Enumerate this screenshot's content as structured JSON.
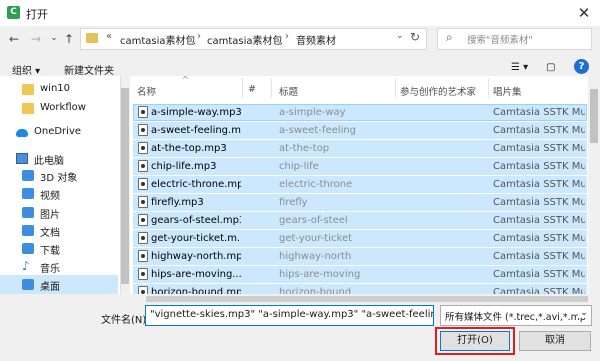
{
  "window": {
    "title": "打开",
    "app_icon_glyph": "C",
    "close_glyph": "✕"
  },
  "address_bar": {
    "back_glyph": "←",
    "forward_glyph": "→",
    "recent_glyph": "⌄",
    "up_glyph": "↑",
    "overflow": "«",
    "crumbs": [
      "camtasia素材包",
      "camtasia素材包",
      "音频素材"
    ],
    "separator": "›",
    "dropdown_glyph": "⌄",
    "refresh_glyph": "↻"
  },
  "search": {
    "placeholder": "搜索\"音频素材\"",
    "icon_glyph": "⌕"
  },
  "toolbar": {
    "organize": "组织 ▾",
    "new_folder": "新建文件夹",
    "view_glyph": "☰ ▾",
    "pane_glyph": "▢",
    "help_glyph": "?"
  },
  "nav": {
    "items": [
      {
        "label": "win10",
        "icon": "folder-icon",
        "selected": false
      },
      {
        "label": "Workflow",
        "icon": "folder-icon",
        "selected": false
      },
      {
        "label": "OneDrive",
        "icon": "cloud-icon",
        "selected": false
      },
      {
        "label": "此电脑",
        "icon": "computer-icon",
        "selected": false
      },
      {
        "label": "3D 对象",
        "icon": "3d-objects-icon",
        "selected": false
      },
      {
        "label": "视频",
        "icon": "video-icon",
        "selected": false
      },
      {
        "label": "图片",
        "icon": "pictures-icon",
        "selected": false
      },
      {
        "label": "文档",
        "icon": "documents-icon",
        "selected": false
      },
      {
        "label": "下载",
        "icon": "download-icon",
        "selected": false
      },
      {
        "label": "音乐",
        "icon": "music-icon",
        "selected": false
      },
      {
        "label": "桌面",
        "icon": "desktop-icon",
        "selected": true
      }
    ]
  },
  "file_list": {
    "columns": [
      "名称",
      "#",
      "标题",
      "参与创作的艺术家",
      "唱片集"
    ],
    "sort_glyph": "^",
    "rows": [
      {
        "name": "a-simple-way.mp3",
        "title": "a-simple-way",
        "album": "Camtasia SSTK Mu..."
      },
      {
        "name": "a-sweet-feeling.m...",
        "title": "a-sweet-feeling",
        "album": "Camtasia SSTK Mu..."
      },
      {
        "name": "at-the-top.mp3",
        "title": "at-the-top",
        "album": "Camtasia SSTK Mu..."
      },
      {
        "name": "chip-life.mp3",
        "title": "chip-life",
        "album": "Camtasia SSTK Mu..."
      },
      {
        "name": "electric-throne.mp3",
        "title": "electric-throne",
        "album": "Camtasia SSTK Mu..."
      },
      {
        "name": "firefly.mp3",
        "title": "firefly",
        "album": "Camtasia SSTK Mu..."
      },
      {
        "name": "gears-of-steel.mp3",
        "title": "gears-of-steel",
        "album": "Camtasia SSTK Mu..."
      },
      {
        "name": "get-your-ticket.m...",
        "title": "get-your-ticket",
        "album": "Camtasia SSTK Mu..."
      },
      {
        "name": "highway-north.mp3",
        "title": "highway-north",
        "album": "Camtasia SSTK Mu..."
      },
      {
        "name": "hips-are-moving....",
        "title": "hips-are-moving",
        "album": "Camtasia SSTK Mu..."
      },
      {
        "name": "horizon-bound.mp3",
        "title": "horizon-bound",
        "album": "Camtasia SSTK Mu..."
      }
    ]
  },
  "bottom": {
    "filename_label": "文件名(N):",
    "filename_value": "\"vignette-skies.mp3\" \"a-simple-way.mp3\" \"a-sweet-feeling.m",
    "filetype_value": "所有媒体文件 (*.trec,*.avi,*.mp",
    "filetype_arrow": "⌄",
    "open_button": "打开(O)",
    "cancel_button": "取消"
  },
  "colors": {
    "selection": "#cce8ff",
    "highlight_box": "#e21d1d",
    "accent": "#0078d7"
  }
}
